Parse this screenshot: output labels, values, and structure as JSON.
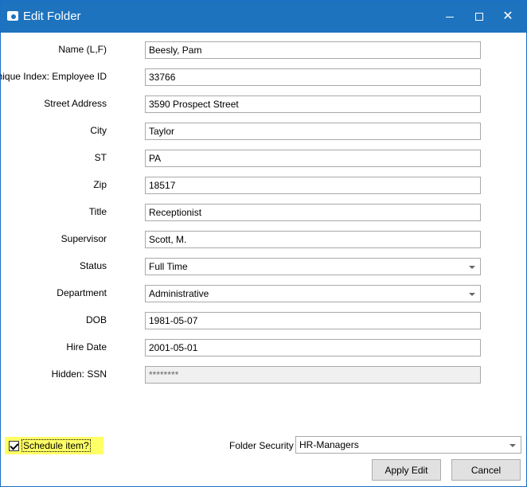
{
  "window": {
    "title": "Edit Folder",
    "icon": "camera-icon"
  },
  "form": {
    "fields": [
      {
        "label": "Name (L,F)",
        "value": "Beesly, Pam",
        "type": "text"
      },
      {
        "label": "Unique Index: Employee ID",
        "value": "33766",
        "type": "text"
      },
      {
        "label": "Street Address",
        "value": "3590 Prospect Street",
        "type": "text"
      },
      {
        "label": "City",
        "value": "Taylor",
        "type": "text"
      },
      {
        "label": "ST",
        "value": "PA",
        "type": "text"
      },
      {
        "label": "Zip",
        "value": "18517",
        "type": "text"
      },
      {
        "label": "Title",
        "value": "Receptionist",
        "type": "text"
      },
      {
        "label": "Supervisor",
        "value": "Scott, M.",
        "type": "text"
      },
      {
        "label": "Status",
        "value": "Full Time",
        "type": "select"
      },
      {
        "label": "Department",
        "value": "Administrative",
        "type": "select"
      },
      {
        "label": "DOB",
        "value": "1981-05-07",
        "type": "text"
      },
      {
        "label": "Hire Date",
        "value": "2001-05-01",
        "type": "text"
      },
      {
        "label": "Hidden: SSN",
        "value": "********",
        "type": "password-disabled"
      }
    ]
  },
  "footer": {
    "schedule_label": "Schedule item?",
    "schedule_checked": true,
    "schedule_highlight": "#ffff66",
    "security_label": "Folder Security",
    "security_value": "HR-Managers",
    "apply_label": "Apply Edit",
    "cancel_label": "Cancel"
  },
  "colors": {
    "titlebar": "#1e73be",
    "field_border": "#a9a9a9",
    "button_bg": "#e1e1e1"
  }
}
